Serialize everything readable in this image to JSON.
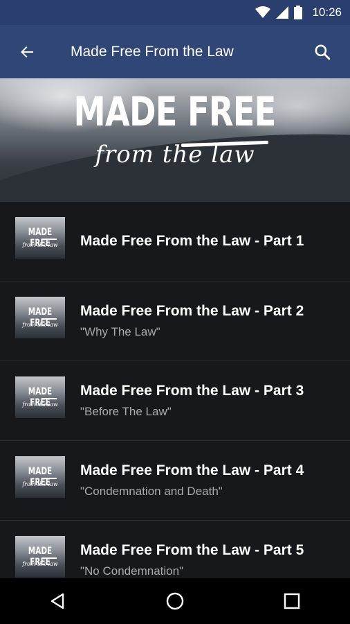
{
  "status_bar": {
    "time": "10:26",
    "icons": [
      "wifi-icon",
      "signal-icon",
      "battery-icon"
    ]
  },
  "app_bar": {
    "title": "Made Free From the Law",
    "back_icon": "arrow-back-icon",
    "search_icon": "search-icon"
  },
  "hero": {
    "title": "MADE FREE",
    "subtitle": "from the law"
  },
  "thumbnail": {
    "title": "MADE FREE",
    "subtitle": "from the law"
  },
  "items": [
    {
      "title": "Made Free From the Law - Part 1",
      "subtitle": ""
    },
    {
      "title": "Made Free From the Law - Part 2",
      "subtitle": "\"Why The Law\""
    },
    {
      "title": "Made Free From the Law - Part 3",
      "subtitle": "\"Before The Law\""
    },
    {
      "title": "Made Free From the Law - Part 4",
      "subtitle": "\"Condemnation and Death\""
    },
    {
      "title": "Made Free From the Law - Part 5",
      "subtitle": "\"No Condemnation\""
    }
  ],
  "nav_bar": {
    "icons": [
      "back-triangle-icon",
      "home-circle-icon",
      "recents-square-icon"
    ]
  },
  "colors": {
    "app_bar": "#2f4676",
    "status_bar": "#2a3f6d",
    "background": "#17181b",
    "subtitle": "#a8abb0"
  }
}
